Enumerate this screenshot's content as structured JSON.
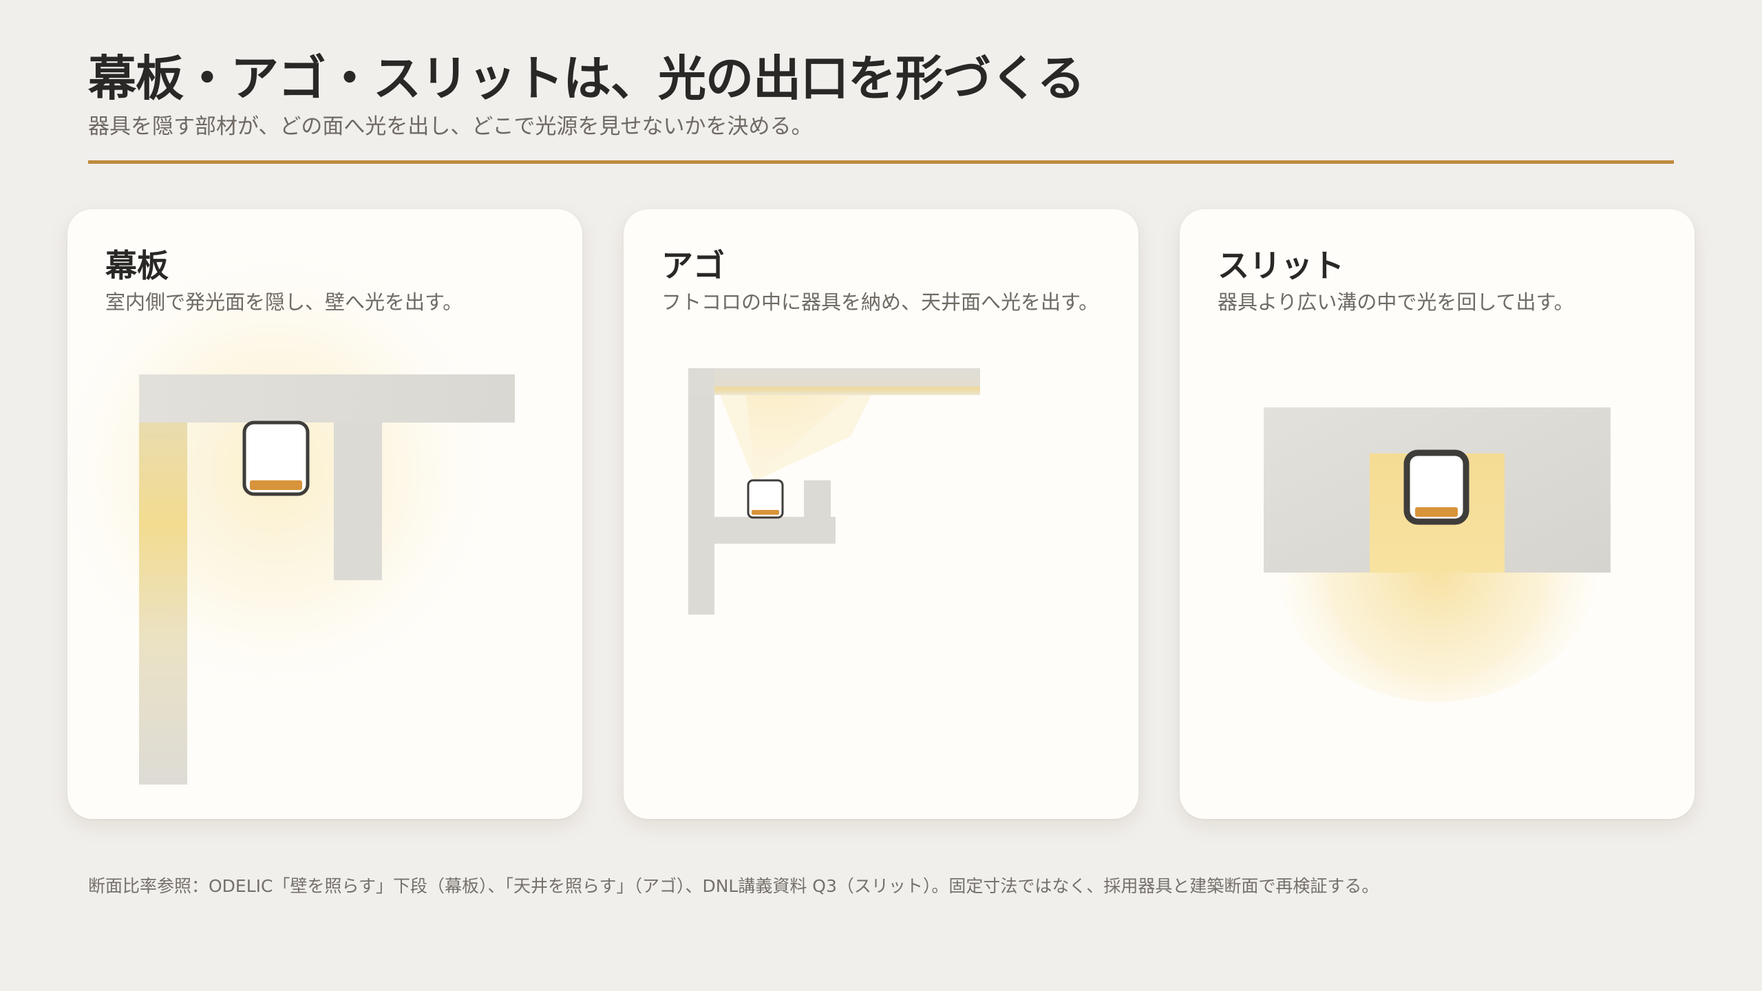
{
  "header": {
    "title": "幕板・アゴ・スリットは、光の出口を形づくる",
    "subtitle": "器具を隠す部材が、どの面へ光を出し、どこで光源を見せないかを決める。"
  },
  "cards": [
    {
      "title": "幕板",
      "description": "室内側で発光面を隠し、壁へ光を出す。"
    },
    {
      "title": "アゴ",
      "description": "フトコロの中に器具を納め、天井面へ光を出す。"
    },
    {
      "title": "スリット",
      "description": "器具より広い溝の中で光を回して出す。"
    }
  ],
  "footnote": "断面比率参照：ODELIC「壁を照らす」下段（幕板）、「天井を照らす」（アゴ）、DNL講義資料 Q3（スリット）。固定寸法ではなく、採用器具と建築断面で再検証する。",
  "colors": {
    "background": "#f1efec",
    "card": "#fefdf9",
    "accent": "#bf8a3e",
    "structure": "#dddbd5",
    "light": "#f7dd8e",
    "fixture_frame": "#3f3d3a",
    "led": "#d8943a"
  },
  "icons": {
    "fixture": "led-fixture-icon"
  }
}
